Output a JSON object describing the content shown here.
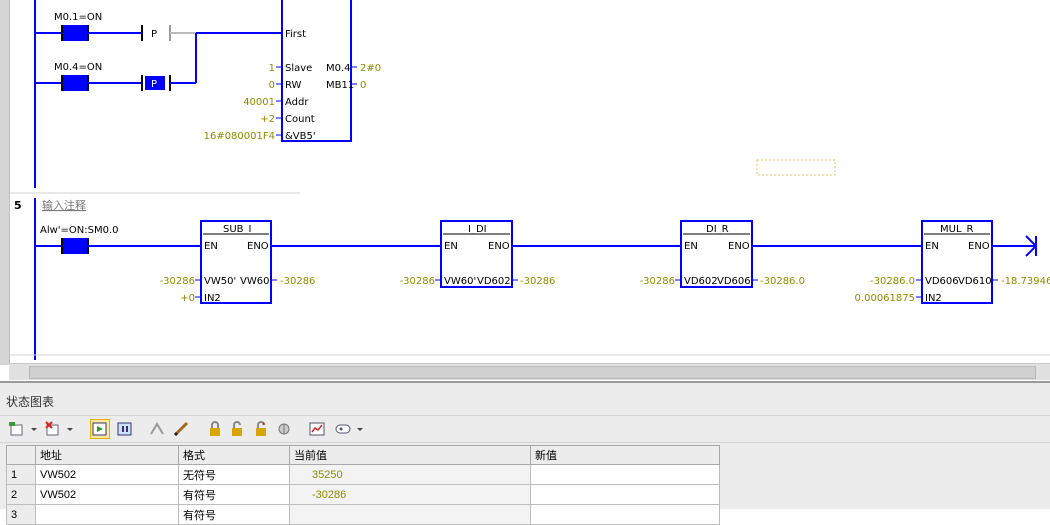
{
  "network_top": {
    "contact1_label": "M0.1=ON",
    "pulse_label": "P",
    "contact2_label": "M0.4=ON",
    "pulse2_label": "P",
    "block_pins": [
      "First",
      "Slave",
      "RW",
      "Addr",
      "Count",
      "&VB5'"
    ],
    "inputs": [
      "1",
      "0",
      "40001",
      "+2",
      "16#080001F4"
    ],
    "outputs": [
      "M0.4",
      "MB11"
    ],
    "output_values": [
      "2#0",
      "0"
    ]
  },
  "network5": {
    "number": "5",
    "comment": "输入注释",
    "contact_label": "Alw'=ON:SM0.0",
    "blocks": [
      {
        "title": "SUB_I",
        "en": "EN",
        "eno": "ENO",
        "in1": "VW50'",
        "out": "VW60'",
        "in2": "IN2",
        "in1_val": "-30286",
        "out_val": "-30286",
        "in2_val": "+0"
      },
      {
        "title": "I_DI",
        "en": "EN",
        "eno": "ENO",
        "in1": "VW60'",
        "out": "VD602",
        "in1_val": "-30286",
        "out_val": "-30286"
      },
      {
        "title": "DI_R",
        "en": "EN",
        "eno": "ENO",
        "in1": "VD602",
        "out": "VD606",
        "in1_val": "-30286",
        "out_val": "-30286.0"
      },
      {
        "title": "MUL_R",
        "en": "EN",
        "eno": "ENO",
        "in1": "VD606",
        "out": "VD610",
        "in2": "IN2",
        "in1_val": "-30286.0",
        "out_val": "-18.73946",
        "in2_val": "0.00061875"
      }
    ]
  },
  "status_chart": {
    "title": "状态图表",
    "columns": [
      "地址",
      "格式",
      "当前值",
      "新值"
    ],
    "rows": [
      {
        "idx": "1",
        "address": "VW502",
        "format": "无符号",
        "current": "35250",
        "new": ""
      },
      {
        "idx": "2",
        "address": "VW502",
        "format": "有符号",
        "current": "-30286",
        "new": ""
      },
      {
        "idx": "3",
        "address": "",
        "format": "有符号",
        "current": "",
        "new": ""
      }
    ]
  },
  "colors": {
    "rail": "#0000ff",
    "value": "#8c8c00",
    "contact_fill": "#0000ff"
  }
}
